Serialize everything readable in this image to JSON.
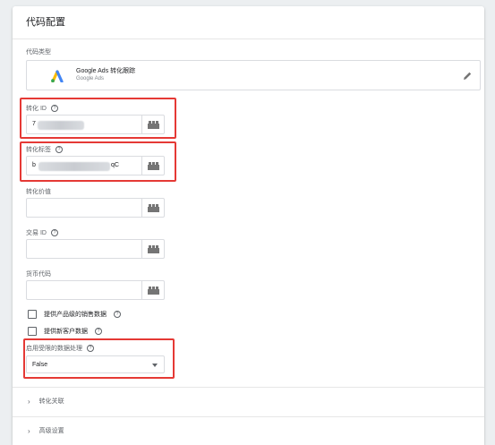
{
  "card": {
    "title": "代码配置",
    "tag_type_label": "代码类型",
    "tag": {
      "name": "Google Ads 转化跟踪",
      "subtitle": "Google Ads",
      "logo": "google-ads-logo",
      "edit_icon": "pencil-icon"
    },
    "fields": {
      "conversion_id": {
        "label": "转化 ID",
        "value": "7",
        "help_icon": "help-icon"
      },
      "conversion_label": {
        "label": "转化标签",
        "value_prefix": "b",
        "value_suffix": "qC",
        "help_icon": "help-icon"
      },
      "conversion_value": {
        "label": "转化价值",
        "value": ""
      },
      "transaction_id": {
        "label": "交易 ID",
        "value": "",
        "help_icon": "help-icon"
      },
      "currency_code": {
        "label": "货币代码",
        "value": ""
      }
    },
    "checkboxes": [
      {
        "label": "提供产品级的销售数据",
        "checked": false,
        "help_icon": "help-icon"
      },
      {
        "label": "提供新客户数据",
        "checked": false,
        "help_icon": "help-icon"
      }
    ],
    "restricted_data": {
      "label": "启用受限的数据处理",
      "selected": "False",
      "help_icon": "help-icon"
    },
    "sections": [
      {
        "label": "转化关联",
        "icon": "chevron-right-icon"
      },
      {
        "label": "高级设置",
        "icon": "chevron-right-icon"
      }
    ]
  },
  "colors": {
    "highlight": "#e53935",
    "ads_blue": "#4285f4",
    "ads_yellow": "#fbbc04",
    "ads_green": "#34a853"
  }
}
